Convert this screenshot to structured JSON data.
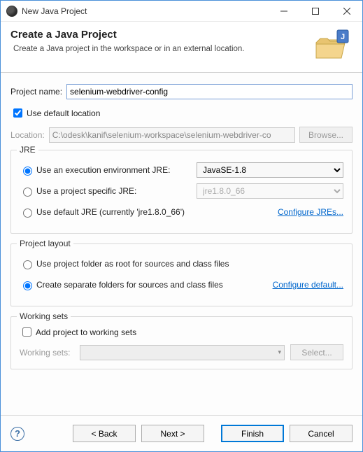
{
  "titlebar": {
    "title": "New Java Project"
  },
  "banner": {
    "title": "Create a Java Project",
    "description": "Create a Java project in the workspace or in an external location."
  },
  "project": {
    "name_label": "Project name:",
    "name_value": "selenium-webdriver-config",
    "use_default_location_label": "Use default location",
    "use_default_location_checked": true,
    "location_label": "Location:",
    "location_value": "C:\\odesk\\kanif\\selenium-workspace\\selenium-webdriver-co",
    "browse_label": "Browse..."
  },
  "jre": {
    "group_title": "JRE",
    "opt_exec_label": "Use an execution environment JRE:",
    "opt_exec_value": "JavaSE-1.8",
    "opt_specific_label": "Use a project specific JRE:",
    "opt_specific_value": "jre1.8.0_66",
    "opt_default_label": "Use default JRE (currently 'jre1.8.0_66')",
    "configure_link": "Configure JREs...",
    "selected": "exec"
  },
  "layout": {
    "group_title": "Project layout",
    "opt_root_label": "Use project folder as root for sources and class files",
    "opt_separate_label": "Create separate folders for sources and class files",
    "configure_link": "Configure default...",
    "selected": "separate"
  },
  "working_sets": {
    "group_title": "Working sets",
    "add_label": "Add project to working sets",
    "add_checked": false,
    "label": "Working sets:",
    "select_label": "Select..."
  },
  "buttons": {
    "back": "< Back",
    "next": "Next >",
    "finish": "Finish",
    "cancel": "Cancel"
  }
}
